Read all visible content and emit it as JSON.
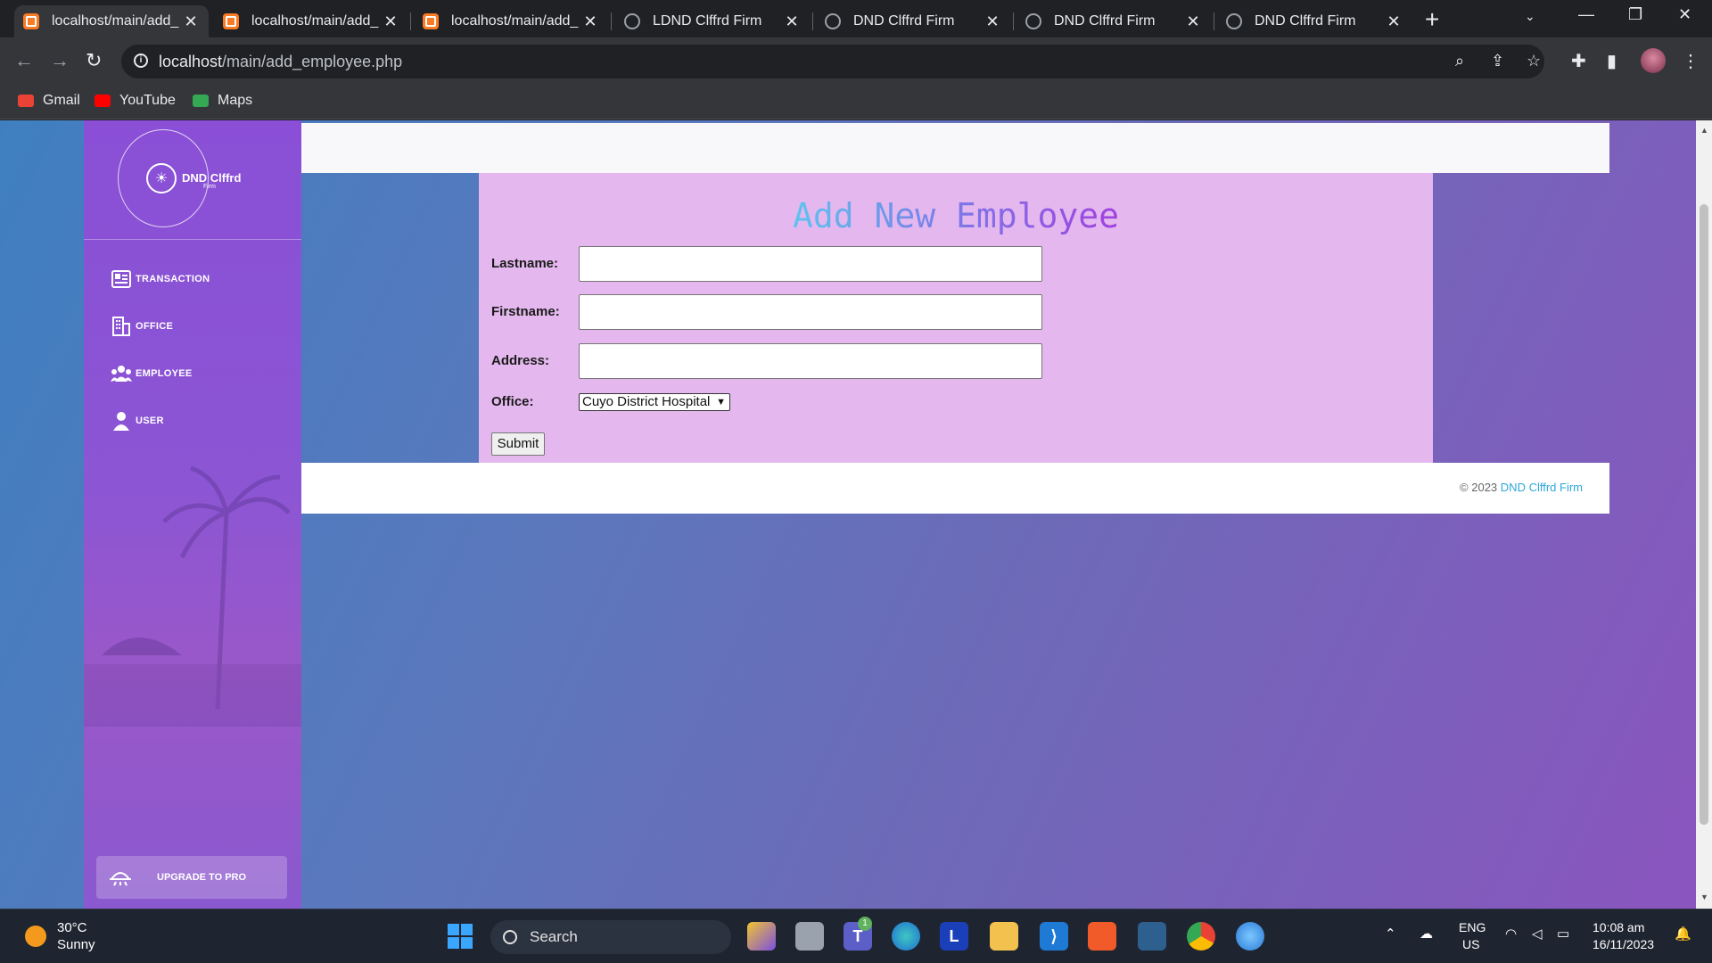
{
  "browser": {
    "tabs": [
      {
        "title": "localhost/main/add_",
        "type": "xampp",
        "active": true
      },
      {
        "title": "localhost/main/add_",
        "type": "xampp",
        "active": false
      },
      {
        "title": "localhost/main/add_",
        "type": "xampp",
        "active": false
      },
      {
        "title": "LDND Clffrd Firm",
        "type": "globe",
        "active": false
      },
      {
        "title": "DND Clffrd Firm",
        "type": "globe",
        "active": false
      },
      {
        "title": "DND Clffrd Firm",
        "type": "globe",
        "active": false
      },
      {
        "title": "DND Clffrd Firm",
        "type": "globe",
        "active": false
      }
    ],
    "url_host": "localhost",
    "url_path": "/main/add_employee.php",
    "bookmarks": [
      {
        "label": "Gmail",
        "color": "#ea4335"
      },
      {
        "label": "YouTube",
        "color": "#ff0000"
      },
      {
        "label": "Maps",
        "color": "#34a853"
      }
    ]
  },
  "sidebar": {
    "brand_name": "DND Clffrd",
    "brand_sub": "Firm",
    "items": [
      {
        "label": "TRANSACTION",
        "icon": "newspaper-icon"
      },
      {
        "label": "OFFICE",
        "icon": "building-icon"
      },
      {
        "label": "EMPLOYEE",
        "icon": "users-icon"
      },
      {
        "label": "USER",
        "icon": "user-icon"
      }
    ],
    "upgrade_label": "UPGRADE TO PRO"
  },
  "form": {
    "title": "Add New Employee",
    "lastname_label": "Lastname:",
    "lastname_value": "",
    "firstname_label": "Firstname:",
    "firstname_value": "",
    "address_label": "Address:",
    "address_value": "",
    "office_label": "Office:",
    "office_selected": "Cuyo District Hospital",
    "submit_label": "Submit"
  },
  "footer": {
    "copyright": "© 2023",
    "brand_link": "DND Clffrd Firm"
  },
  "taskbar": {
    "temperature": "30°C",
    "condition": "Sunny",
    "search_label": "Search",
    "teams_badge": "1",
    "language": "ENG",
    "region": "US",
    "time": "10:08 am",
    "date": "16/11/2023"
  },
  "colors": {
    "sidebar": "#8a4fd6",
    "panel": "#e4b8ee",
    "title_start": "#5ec4ee",
    "title_end": "#a040e0",
    "link": "#2fa8d8"
  }
}
